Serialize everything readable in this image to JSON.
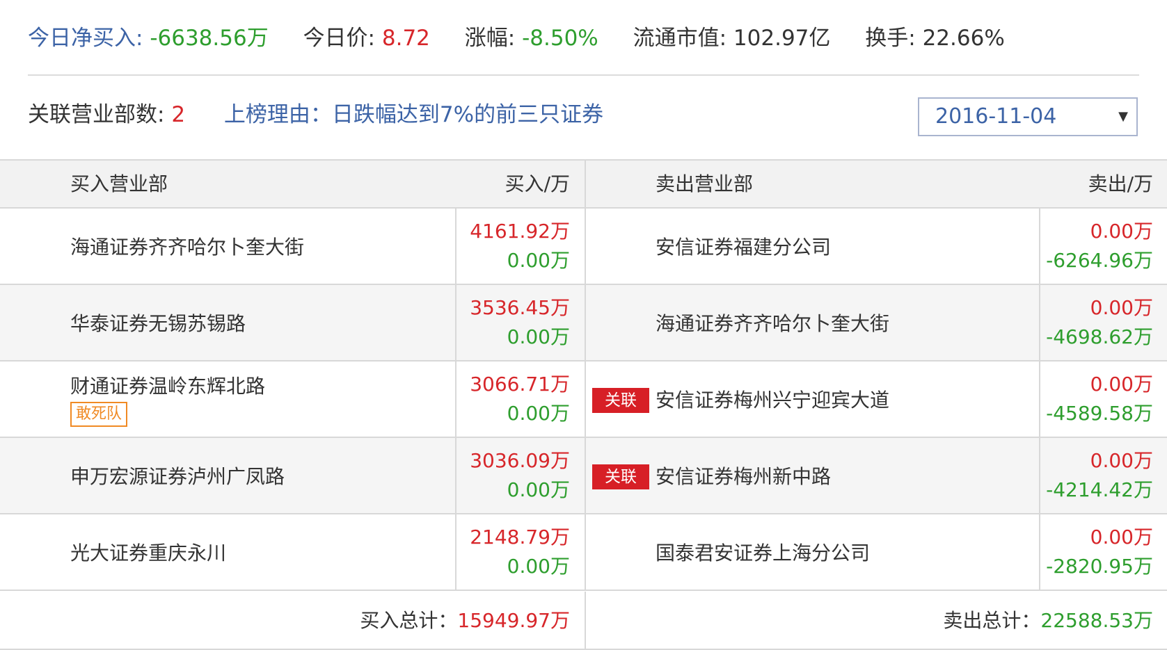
{
  "summary": {
    "net_buy_label": "今日净买入:",
    "net_buy_value": "-6638.56万",
    "price_label": "今日价:",
    "price_value": "8.72",
    "change_label": "涨幅:",
    "change_value": "-8.50%",
    "mktcap_label": "流通市值:",
    "mktcap_value": "102.97亿",
    "turnover_label": "换手:",
    "turnover_value": "22.66%"
  },
  "info": {
    "related_label": "关联营业部数:",
    "related_count": "2",
    "reason": "上榜理由：日跌幅达到7%的前三只证券",
    "date_selected": "2016-11-04",
    "caret": "▼"
  },
  "table": {
    "headers": {
      "buy_dept": "买入营业部",
      "buy_amount": "买入/万",
      "sell_dept": "卖出营业部",
      "sell_amount": "卖出/万"
    },
    "rows": [
      {
        "buy_name": "海通证券齐齐哈尔卜奎大街",
        "buy_in": "4161.92万",
        "buy_out": "0.00万",
        "sell_name": "安信证券福建分公司",
        "sell_in": "0.00万",
        "sell_out": "-6264.96万"
      },
      {
        "buy_name": "华泰证券无锡苏锡路",
        "buy_in": "3536.45万",
        "buy_out": "0.00万",
        "sell_name": "海通证券齐齐哈尔卜奎大街",
        "sell_in": "0.00万",
        "sell_out": "-4698.62万"
      },
      {
        "buy_name": "财通证券温岭东辉北路",
        "buy_tag": "敢死队",
        "buy_in": "3066.71万",
        "buy_out": "0.00万",
        "sell_tag": "关联",
        "sell_name": "安信证券梅州兴宁迎宾大道",
        "sell_in": "0.00万",
        "sell_out": "-4589.58万"
      },
      {
        "buy_name": "申万宏源证券泸州广凤路",
        "buy_in": "3036.09万",
        "buy_out": "0.00万",
        "sell_tag": "关联",
        "sell_name": "安信证券梅州新中路",
        "sell_in": "0.00万",
        "sell_out": "-4214.42万"
      },
      {
        "buy_name": "光大证券重庆永川",
        "buy_in": "2148.79万",
        "buy_out": "0.00万",
        "sell_name": "国泰君安证券上海分公司",
        "sell_in": "0.00万",
        "sell_out": "-2820.95万"
      }
    ],
    "footer": {
      "buy_total_label": "买入总计：",
      "buy_total_value": "15949.97万",
      "sell_total_label": "卖出总计：",
      "sell_total_value": "22588.53万"
    }
  },
  "colors": {
    "blue": "#3c63a6",
    "green": "#2e9e2e",
    "red": "#d7262a",
    "tag_orange": "#f08a24"
  }
}
